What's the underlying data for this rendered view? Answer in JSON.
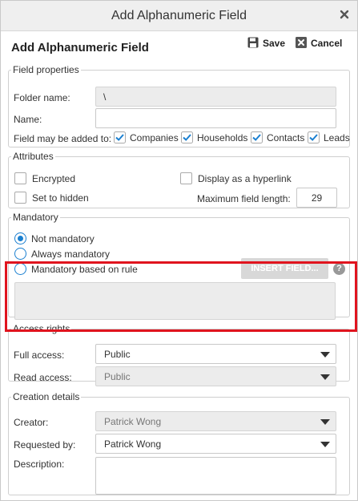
{
  "window": {
    "title": "Add Alphanumeric Field"
  },
  "header": {
    "title": "Add Alphanumeric Field",
    "save_label": "Save",
    "cancel_label": "Cancel"
  },
  "field_properties": {
    "legend": "Field properties",
    "folder_label": "Folder name:",
    "folder_value": "\\",
    "name_label": "Name:",
    "name_value": "",
    "added_to_label": "Field may be added to:",
    "entities": [
      {
        "label": "Companies",
        "checked": true
      },
      {
        "label": "Households",
        "checked": true
      },
      {
        "label": "Contacts",
        "checked": true
      },
      {
        "label": "Leads",
        "checked": true
      }
    ]
  },
  "attributes": {
    "legend": "Attributes",
    "encrypted_label": "Encrypted",
    "encrypted_checked": false,
    "hidden_label": "Set to hidden",
    "hidden_checked": false,
    "hyperlink_label": "Display as a hyperlink",
    "hyperlink_checked": false,
    "max_length_label": "Maximum field length:",
    "max_length_value": "29"
  },
  "mandatory": {
    "legend": "Mandatory",
    "options": [
      {
        "label": "Not mandatory",
        "selected": true
      },
      {
        "label": "Always mandatory",
        "selected": false
      },
      {
        "label": "Mandatory based on rule",
        "selected": false
      }
    ],
    "insert_field_label": "INSERT FIELD...",
    "help_label": "?"
  },
  "access_rights": {
    "legend": "Access rights",
    "full_access_label": "Full access:",
    "full_access_value": "Public",
    "read_access_label": "Read access:",
    "read_access_value": "Public"
  },
  "creation_details": {
    "legend": "Creation details",
    "creator_label": "Creator:",
    "creator_value": "Patrick Wong",
    "requested_by_label": "Requested by:",
    "requested_by_value": "Patrick Wong",
    "description_label": "Description:",
    "description_value": ""
  },
  "colors": {
    "accent": "#1a7fd0",
    "highlight": "#e0141e",
    "titlebar": "#efefef",
    "disabled_field": "#ececec"
  },
  "icons": {
    "close": "close-icon",
    "save": "floppy-disk-icon",
    "cancel": "cancel-x-icon",
    "dropdown": "caret-down-icon",
    "check": "checkmark-icon",
    "help": "question-mark-icon"
  }
}
